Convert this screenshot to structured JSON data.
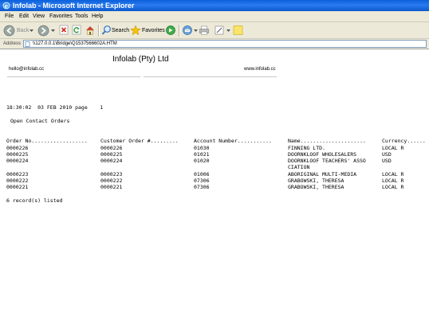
{
  "window": {
    "title": "Infolab - Microsoft Internet Explorer"
  },
  "menu": [
    "File",
    "Edit",
    "View",
    "Favorites",
    "Tools",
    "Help"
  ],
  "toolbar": {
    "back_label": "Back",
    "search_label": "Search",
    "favorites_label": "Favorites"
  },
  "address": {
    "label": "Address",
    "value": "\\\\127.0.0.1\\Bridge\\Q1537566602A.HTM"
  },
  "report": {
    "company": "Infolab (Pty) Ltd",
    "email": "hello@infolab.cc",
    "website": "www.infolab.cc",
    "timestamp_line": "18:30:02  03 FEB 2010 page    1",
    "report_title": "Open Contact Orders",
    "columns": [
      "Order No..................",
      "Customer Order #.........",
      "Account Number...........",
      "Name.....................",
      "Currency......"
    ],
    "rows": [
      [
        "0000226",
        "0000226",
        "01030",
        "FINNING LTD.",
        "LOCAL R"
      ],
      [
        "0000225",
        "0000225",
        "01021",
        "DOORNKLOOF WHOLESALERS",
        "USD"
      ],
      [
        "0000224",
        "0000224",
        "01020",
        "DOORNKLOOF TEACHERS' ASSO",
        "USD"
      ],
      [
        "",
        "",
        "",
        "CIATION",
        ""
      ],
      [
        "0000223",
        "0000223",
        "01006",
        "ABORIGINAL MULTI-MEDIA",
        "LOCAL R"
      ],
      [
        "0000222",
        "0000222",
        "07306",
        "GRABOWSKI, THERESA",
        "LOCAL R"
      ],
      [
        "0000221",
        "0000221",
        "07306",
        "GRABOWSKI, THERESA",
        "LOCAL R"
      ]
    ],
    "footer": "6 record(s) listed"
  },
  "colors": {
    "titlebar": "#0a5fd8",
    "chrome": "#ece9d8"
  }
}
